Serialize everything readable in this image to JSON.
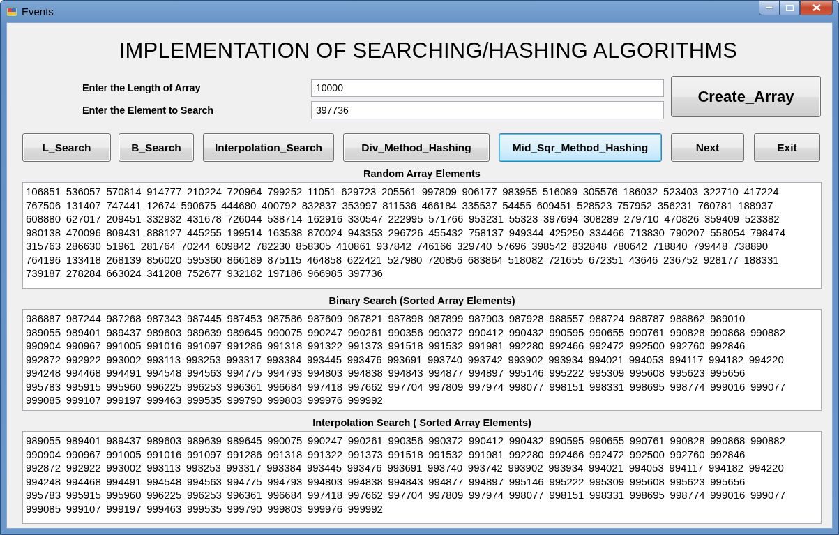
{
  "window": {
    "title": "Events"
  },
  "heading": "IMPLEMENTATION OF SEARCHING/HASHING ALGORITHMS",
  "fields": [
    {
      "label": "Enter the Length of Array",
      "value": "10000"
    },
    {
      "label": "Enter the Element to Search",
      "value": "397736"
    }
  ],
  "create_button": "Create_Array",
  "buttons": [
    {
      "label": "L_Search",
      "focused": false
    },
    {
      "label": "B_Search",
      "focused": false
    },
    {
      "label": "Interpolation_Search",
      "focused": false
    },
    {
      "label": "Div_Method_Hashing",
      "focused": false
    },
    {
      "label": "Mid_Sqr_Method_Hashing",
      "focused": true
    },
    {
      "label": "Next",
      "focused": false
    },
    {
      "label": "Exit",
      "focused": false
    }
  ],
  "sections": [
    {
      "title": "Random Array Elements",
      "lines": [
        "106851 536057 570814 914777 210224 720964 799252 11051 629723 205561 997809 906177 983955 516089 305576 186032 523403 322710 417224",
        "767506 131407 747441 12674 590675 444680 400792 832837 353997 811536 466184 335537 54455 609451 528523 757952 356231 760781 188937",
        "608880 627017 209451 332932 431678 726044 538714 162916 330547 222995 571766 953231 55323 397694 308289 279710 470826 359409 523382",
        "980138 470096 809431 888127 445255 199514 163538 870024 943353 296726 455432 758137 949344 425250 334466 713830 790207 558054 798474",
        "315763 286630 51961 281764 70244 609842 782230 858305 410861 937842 746166 329740 57696 398542 832848 780642 718840 799448 738890",
        "764196 133418 268139 856020 595360 866189 875115 464858 622421 527980 720856 683864 518082 721655 672351 43646 236752 928177 188331",
        "739187 278284 663024 341208 752677 932182 197186 966985 397736"
      ]
    },
    {
      "title": "Binary Search (Sorted Array Elements)",
      "lines": [
        "986887 987244 987268 987343 987445 987453 987586 987609 987821 987898 987899 987903 987928 988557 988724 988787 988862 989010",
        "989055 989401 989437 989603 989639 989645 990075 990247 990261 990356 990372 990412 990432 990595 990655 990761 990828 990868 990882",
        "990904 990967 991005 991016 991097 991286 991318 991322 991373 991518 991532 991981 992280 992466 992472 992500 992760 992846",
        "992872 992922 993002 993113 993253 993317 993384 993445 993476 993691 993740 993742 993902 993934 994021 994053 994117 994182 994220",
        "994248 994468 994491 994548 994563 994775 994793 994803 994838 994843 994877 994897 995146 995222 995309 995608 995623 995656",
        "995783 995915 995960 996225 996253 996361 996684 997418 997662 997704 997809 997974 998077 998151 998331 998695 998774 999016 999077",
        "999085 999107 999197 999463 999535 999790 999803 999976 999992"
      ]
    },
    {
      "title": "Interpolation Search ( Sorted Array Elements)",
      "lines": [
        "989055 989401 989437 989603 989639 989645 990075 990247 990261 990356 990372 990412 990432 990595 990655 990761 990828 990868 990882",
        "990904 990967 991005 991016 991097 991286 991318 991322 991373 991518 991532 991981 992280 992466 992472 992500 992760 992846",
        "992872 992922 993002 993113 993253 993317 993384 993445 993476 993691 993740 993742 993902 993934 994021 994053 994117 994182 994220",
        "994248 994468 994491 994548 994563 994775 994793 994803 994838 994843 994877 994897 995146 995222 995309 995608 995623 995656",
        "995783 995915 995960 996225 996253 996361 996684 997418 997662 997704 997809 997974 998077 998151 998331 998695 998774 999016 999077",
        "999085 999107 999197 999463 999535 999790 999803 999976 999992"
      ]
    }
  ]
}
